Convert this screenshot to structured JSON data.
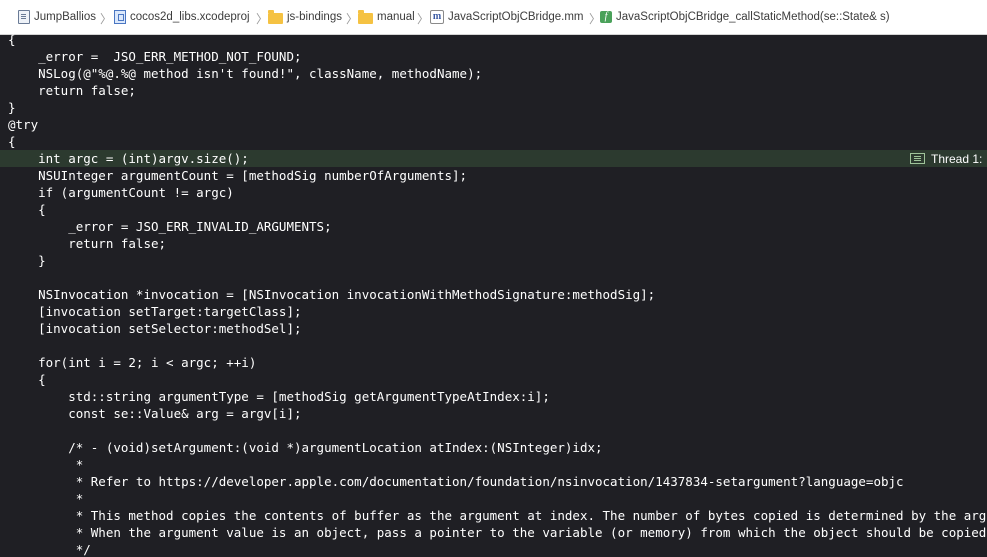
{
  "jumpbar": {
    "items": [
      {
        "label": "JumpBallios",
        "icon": "document-icon"
      },
      {
        "label": "cocos2d_libs.xcodeproj",
        "icon": "xcodeproj-icon"
      },
      {
        "label": "js-bindings",
        "icon": "folder-icon"
      },
      {
        "label": "manual",
        "icon": "folder-icon"
      },
      {
        "label": "JavaScriptObjCBridge.mm",
        "icon": "m-file-icon"
      },
      {
        "label": "JavaScriptObjCBridge_callStaticMethod(se::State& s)",
        "icon": "function-icon"
      }
    ],
    "separator": "〉"
  },
  "thread_indicator": {
    "label": "Thread 1:",
    "icon": "thread-icon"
  },
  "highlight_color": "#2c3a2f",
  "code": {
    "lines": [
      "{",
      "    _error =  JSO_ERR_METHOD_NOT_FOUND;",
      "    NSLog(@\"%@.%@ method isn't found!\", className, methodName);",
      "    return false;",
      "}",
      "@try",
      "{",
      "    int argc = (int)argv.size();",
      "    NSUInteger argumentCount = [methodSig numberOfArguments];",
      "    if (argumentCount != argc)",
      "    {",
      "        _error = JSO_ERR_INVALID_ARGUMENTS;",
      "        return false;",
      "    }",
      "",
      "    NSInvocation *invocation = [NSInvocation invocationWithMethodSignature:methodSig];",
      "    [invocation setTarget:targetClass];",
      "    [invocation setSelector:methodSel];",
      "",
      "    for(int i = 2; i < argc; ++i)",
      "    {",
      "        std::string argumentType = [methodSig getArgumentTypeAtIndex:i];",
      "        const se::Value& arg = argv[i];",
      "",
      "        /* - (void)setArgument:(void *)argumentLocation atIndex:(NSInteger)idx;",
      "         *",
      "         * Refer to https://developer.apple.com/documentation/foundation/nsinvocation/1437834-setargument?language=objc",
      "         *",
      "         * This method copies the contents of buffer as the argument at index. The number of bytes copied is determined by the argum",
      "         * When the argument value is an object, pass a pointer to the variable (or memory) from which the object should be copied:",
      "         */"
    ],
    "highlighted_line": 8
  }
}
